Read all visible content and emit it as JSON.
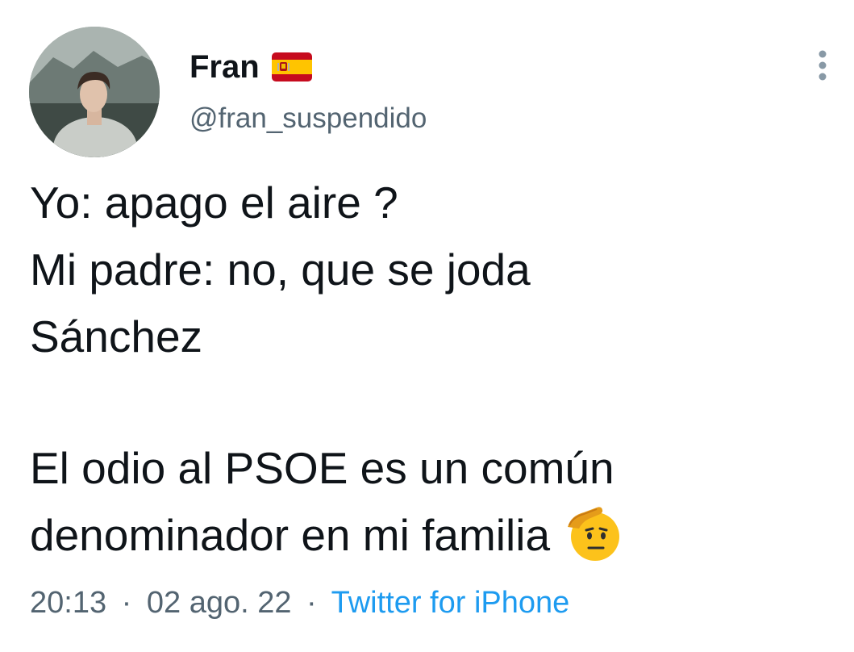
{
  "tweet": {
    "author": {
      "display_name": "Fran",
      "flag_icon": "spain-flag-icon",
      "handle": "@fran_suspendido",
      "avatar_icon": "profile-photo"
    },
    "text_lines": [
      "Yo: apago el aire ?",
      "Mi padre: no, que se joda",
      "Sánchez",
      "El odio al PSOE es un común",
      "denominador en mi familia"
    ],
    "emoji": "saluting-face-emoji",
    "meta": {
      "time": "20:13",
      "separator": "·",
      "date": "02 ago. 22",
      "source": "Twitter for iPhone"
    },
    "more_icon": "more-vertical-icon"
  },
  "colors": {
    "text": "#0f1419",
    "secondary": "#536471",
    "link": "#1d9bf0"
  }
}
